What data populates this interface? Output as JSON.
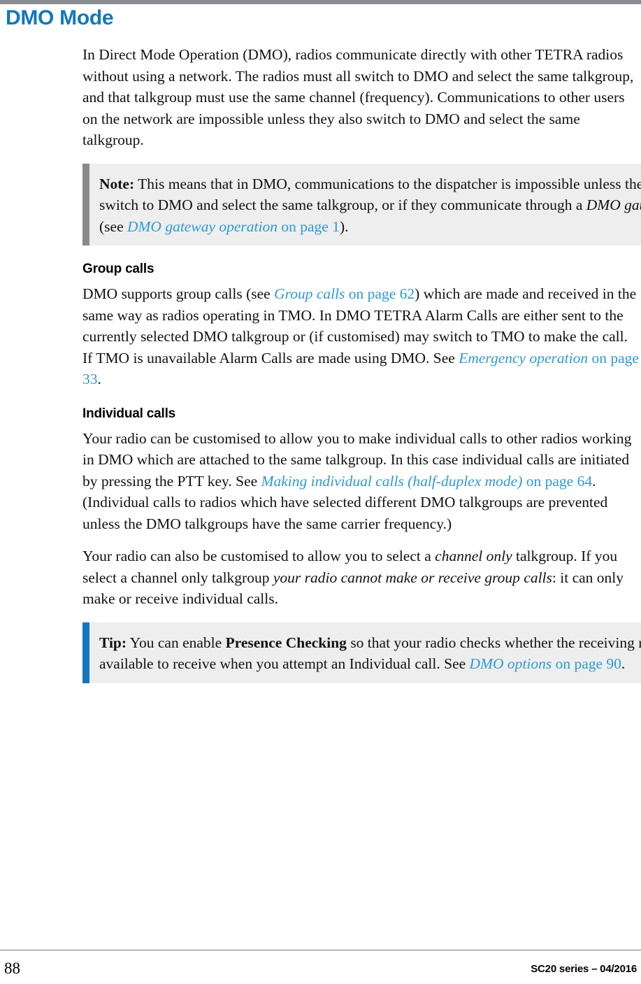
{
  "document": {
    "title": "DMO Mode",
    "title_color": "#1278bd",
    "link_color": "#2e9ad4",
    "note_bar_color": "#8a8a8e",
    "tip_bar_color": "#1278bd",
    "admon_background": "#eeeeee",
    "top_rule_color": "#8a8d91"
  },
  "intro": {
    "text": "In Direct Mode Operation (DMO), radios communicate directly with other TETRA radios without using a network. The radios must all switch to DMO and select the same talkgroup, and that talkgroup must use the same channel (frequency). Communications to other users on the network are impossible unless they also switch to DMO and select the same talkgroup."
  },
  "note_box": {
    "kind": "Note",
    "label": "Note:",
    "part1": "  This means that in DMO, communications to the dispatcher is impossible unless they also switch to DMO and select the same talkgroup, or if they communicate through a ",
    "term_italic": "DMO gateway",
    "part2": " (see ",
    "xref_italic": "DMO gateway operation",
    "xref_tail": " on page 1",
    "part3": ")."
  },
  "group_calls": {
    "heading": "Group calls",
    "part1": "DMO supports group calls (see ",
    "xref1_italic": "Group calls",
    "xref1_tail": " on page 62",
    "part2": ") which are made and received in the same way as radios operating in TMO. In DMO TETRA Alarm Calls are either sent to the currently selected DMO talkgroup or (if customised) may switch to TMO to make the call. If TMO is unavailable Alarm Calls are made using DMO. See ",
    "xref2_italic": "Emergency operation",
    "xref2_tail": " on page 33",
    "part3": "."
  },
  "individual_calls": {
    "heading": "Individual calls",
    "para1_part1": "Your radio can be customised to allow you to make individual calls to other radios working in DMO which are attached to the same talkgroup. In this case individual calls are initiated by pressing the PTT key. See ",
    "para1_xref_italic": "Making individual calls (half-duplex mode) ",
    "para1_xref_tail": " on page 64",
    "para1_part2": ". (Individual calls to radios which have selected different DMO talkgroups are prevented unless the DMO talkgroups have the same carrier frequency.)",
    "para2_part1": "Your radio can also be customised to allow you to select a ",
    "para2_it1": "channel only",
    "para2_part2": " talkgroup. If you select a channel only talkgroup ",
    "para2_it2": "your radio cannot make or receive group calls",
    "para2_part3": ": it can only make or receive individual calls."
  },
  "tip_box": {
    "kind": "Tip",
    "label": "Tip:",
    "part1": "  You can enable ",
    "bold_term": "Presence Checking",
    "part2": " so that your radio checks whether the receiving radio is available to receive when you attempt an Individual call. See ",
    "xref_italic": "DMO options",
    "xref_tail": " on page 90",
    "part3": "."
  },
  "footer": {
    "page_number": "88",
    "meta": "SC20 series – 04/2016"
  }
}
